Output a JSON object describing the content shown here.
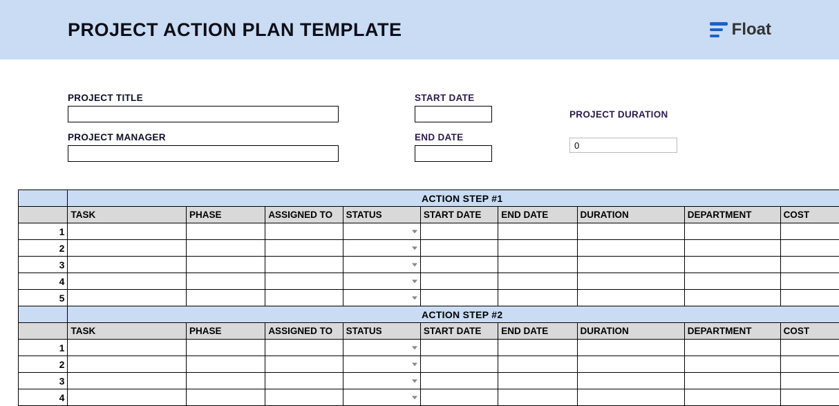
{
  "header": {
    "title": "PROJECT ACTION PLAN TEMPLATE",
    "logo_text": "Float"
  },
  "meta": {
    "project_title_label": "PROJECT TITLE",
    "project_title_value": "",
    "project_manager_label": "PROJECT MANAGER",
    "project_manager_value": "",
    "start_date_label": "START DATE",
    "start_date_value": "",
    "end_date_label": "END DATE",
    "end_date_value": "",
    "project_duration_label": "PROJECT DURATION",
    "project_duration_value": "0"
  },
  "columns": {
    "task": "TASK",
    "phase": "PHASE",
    "assigned_to": "ASSIGNED TO",
    "status": "STATUS",
    "start_date": "START DATE",
    "end_date": "END DATE",
    "duration": "DURATION",
    "department": "DEPARTMENT",
    "cost": "COST"
  },
  "sections": [
    {
      "title": "ACTION STEP #1",
      "rows": [
        {
          "num": "1",
          "task": "",
          "phase": "",
          "assigned_to": "",
          "status": "",
          "start_date": "",
          "end_date": "",
          "duration": "",
          "department": "",
          "cost": ""
        },
        {
          "num": "2",
          "task": "",
          "phase": "",
          "assigned_to": "",
          "status": "",
          "start_date": "",
          "end_date": "",
          "duration": "",
          "department": "",
          "cost": ""
        },
        {
          "num": "3",
          "task": "",
          "phase": "",
          "assigned_to": "",
          "status": "",
          "start_date": "",
          "end_date": "",
          "duration": "",
          "department": "",
          "cost": ""
        },
        {
          "num": "4",
          "task": "",
          "phase": "",
          "assigned_to": "",
          "status": "",
          "start_date": "",
          "end_date": "",
          "duration": "",
          "department": "",
          "cost": ""
        },
        {
          "num": "5",
          "task": "",
          "phase": "",
          "assigned_to": "",
          "status": "",
          "start_date": "",
          "end_date": "",
          "duration": "",
          "department": "",
          "cost": ""
        }
      ]
    },
    {
      "title": "ACTION STEP #2",
      "rows": [
        {
          "num": "1",
          "task": "",
          "phase": "",
          "assigned_to": "",
          "status": "",
          "start_date": "",
          "end_date": "",
          "duration": "",
          "department": "",
          "cost": ""
        },
        {
          "num": "2",
          "task": "",
          "phase": "",
          "assigned_to": "",
          "status": "",
          "start_date": "",
          "end_date": "",
          "duration": "",
          "department": "",
          "cost": ""
        },
        {
          "num": "3",
          "task": "",
          "phase": "",
          "assigned_to": "",
          "status": "",
          "start_date": "",
          "end_date": "",
          "duration": "",
          "department": "",
          "cost": ""
        },
        {
          "num": "4",
          "task": "",
          "phase": "",
          "assigned_to": "",
          "status": "",
          "start_date": "",
          "end_date": "",
          "duration": "",
          "department": "",
          "cost": ""
        }
      ]
    }
  ]
}
